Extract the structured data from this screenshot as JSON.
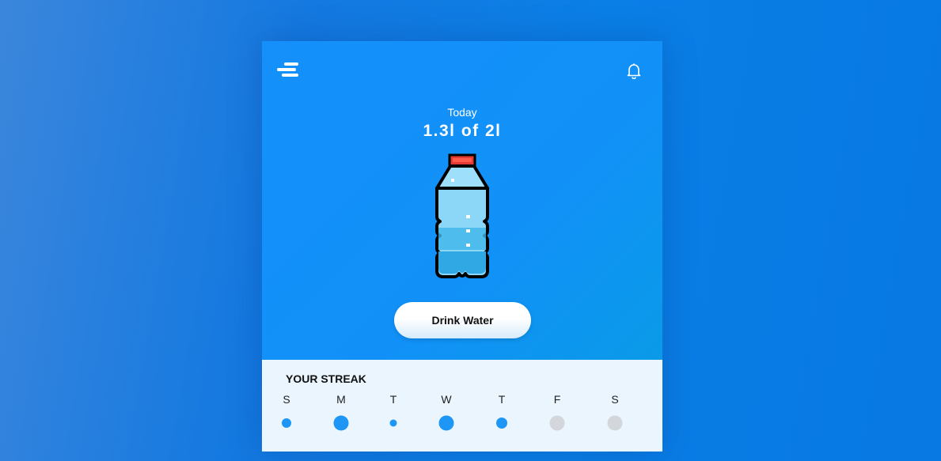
{
  "header": {
    "menu_icon": "menu-icon",
    "bell_icon": "bell-icon"
  },
  "summary": {
    "label": "Today",
    "amount": "1.3l of 2l"
  },
  "action": {
    "drink_label": "Drink Water"
  },
  "colors": {
    "accent": "#1e96f6",
    "inactive": "#d3d7dc"
  },
  "streak": {
    "title": "YOUR STREAK",
    "days": [
      {
        "label": "S",
        "level": 0.5,
        "done": true
      },
      {
        "label": "M",
        "level": 1,
        "done": true
      },
      {
        "label": "T",
        "level": 0.3,
        "done": true
      },
      {
        "label": "W",
        "level": 1,
        "done": true
      },
      {
        "label": "T",
        "level": 0.65,
        "done": true
      },
      {
        "label": "F",
        "level": 1,
        "done": false
      },
      {
        "label": "S",
        "level": 1,
        "done": false
      }
    ]
  }
}
